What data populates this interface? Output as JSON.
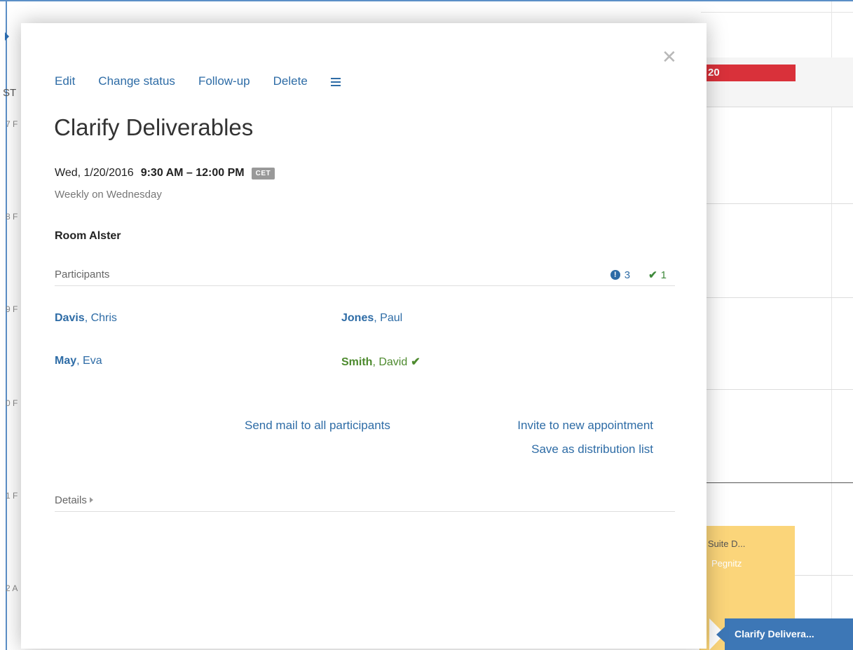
{
  "calendar": {
    "tz_label": "ST",
    "date_badge": "20",
    "hour_labels": [
      "7 F",
      "8 F",
      "9 F",
      "0 F",
      "1 F",
      "2 A"
    ],
    "yellow_event": {
      "title": "p Suite D...",
      "subtitle": "Pegnitz"
    },
    "selected_event": {
      "title": "Clarify Delivera..."
    }
  },
  "modal": {
    "close_icon": "close-icon",
    "toolbar": {
      "edit": "Edit",
      "change_status": "Change status",
      "follow_up": "Follow-up",
      "delete": "Delete",
      "menu_icon": "hamburger-menu-icon"
    },
    "title": "Clarify Deliverables",
    "date": "Wed, 1/20/2016",
    "time": "9:30 AM – 12:00 PM",
    "timezone": "CET",
    "recurrence": "Weekly on Wednesday",
    "location": "Room Alster",
    "participants": {
      "label": "Participants",
      "count_unconfirmed": "3",
      "count_accepted": "1",
      "people": [
        {
          "last": "Davis",
          "first": ", Chris",
          "status": "unconfirmed"
        },
        {
          "last": "Jones",
          "first": ", Paul",
          "status": "unconfirmed"
        },
        {
          "last": "May",
          "first": ", Eva",
          "status": "unconfirmed"
        },
        {
          "last": "Smith",
          "first": ", David",
          "status": "accepted"
        }
      ]
    },
    "actions": {
      "send_mail": "Send mail to all participants",
      "invite": "Invite to new appointment",
      "save_list": "Save as distribution list"
    },
    "details_label": "Details",
    "colors": {
      "link": "#2e6ca6",
      "accepted": "#4d8a2e",
      "badge_red": "#d9313a",
      "event_blue": "#3d77b6",
      "event_yellow": "#fbd57a"
    }
  }
}
